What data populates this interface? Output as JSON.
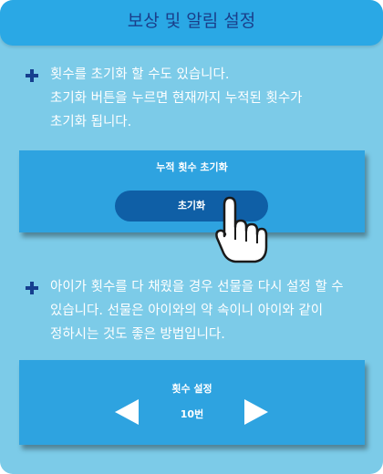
{
  "header": {
    "title": "보상 및 알림 설정"
  },
  "reset_section": {
    "description_lines": [
      "횟수를 초기화 할 수도 있습니다.",
      "초기화 버튼을 누르면 현재까지 누적된 횟수가",
      "초기화 됩니다."
    ],
    "panel_title": "누적 횟수 초기화",
    "button_label": "초기화"
  },
  "gift_section": {
    "description_lines": [
      "아이가 횟수를 다 채웠을 경우 선물을 다시 설정 할 수",
      "있습니다. 선물은 아이와의 약 속이니 아이와 같이",
      "정하시는 것도 좋은 방법입니다."
    ],
    "panel_title": "횟수 설정",
    "count_value": "10번"
  },
  "icons": {
    "bullet": "plus-icon",
    "cursor": "pointing-hand-icon",
    "decrease": "triangle-left-icon",
    "increase": "triangle-right-icon"
  },
  "colors": {
    "background": "#7ccbe8",
    "header": "#2aa8e5",
    "header_text": "#1a3e8a",
    "panel": "#2ea3e0",
    "button": "#0f5fa6",
    "bullet": "#163f8f"
  }
}
